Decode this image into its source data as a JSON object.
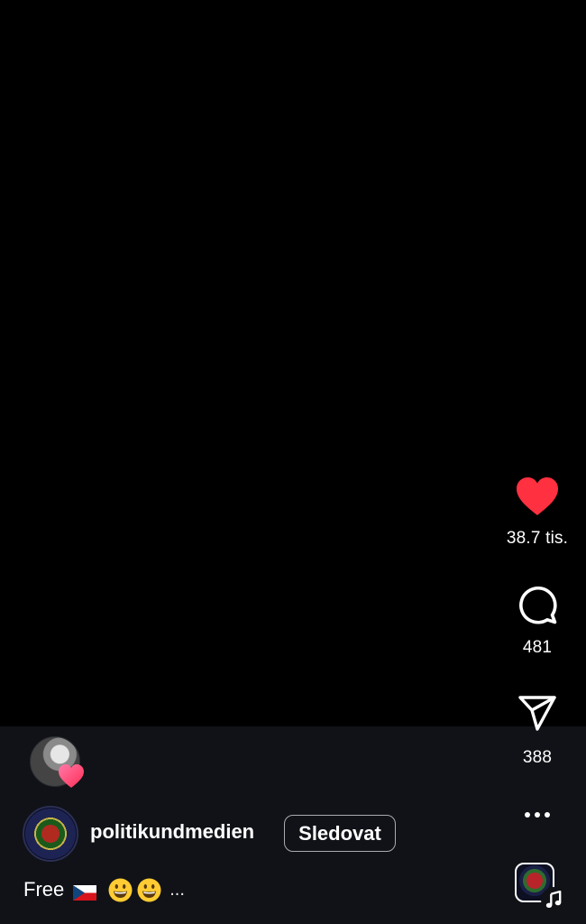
{
  "reel": {
    "likes_count": "38.7 tis.",
    "comments_count": "481",
    "shares_count": "388",
    "liked": true
  },
  "icons": {
    "like": "heart-icon",
    "comment": "comment-bubble-icon",
    "share": "paper-plane-icon",
    "more": "more-horizontal-icon",
    "audio": "music-note-icon"
  },
  "author": {
    "username": "politikundmedien",
    "follow_label": "Sledovat"
  },
  "caption": {
    "text": "Free",
    "flag": "Czech flag emoji",
    "emojis": "grinning-face grinning-face",
    "more_label": "..."
  },
  "colors": {
    "background": "#000000",
    "panel": "#101217",
    "like_red": "#ff3040",
    "text": "#ffffff"
  }
}
